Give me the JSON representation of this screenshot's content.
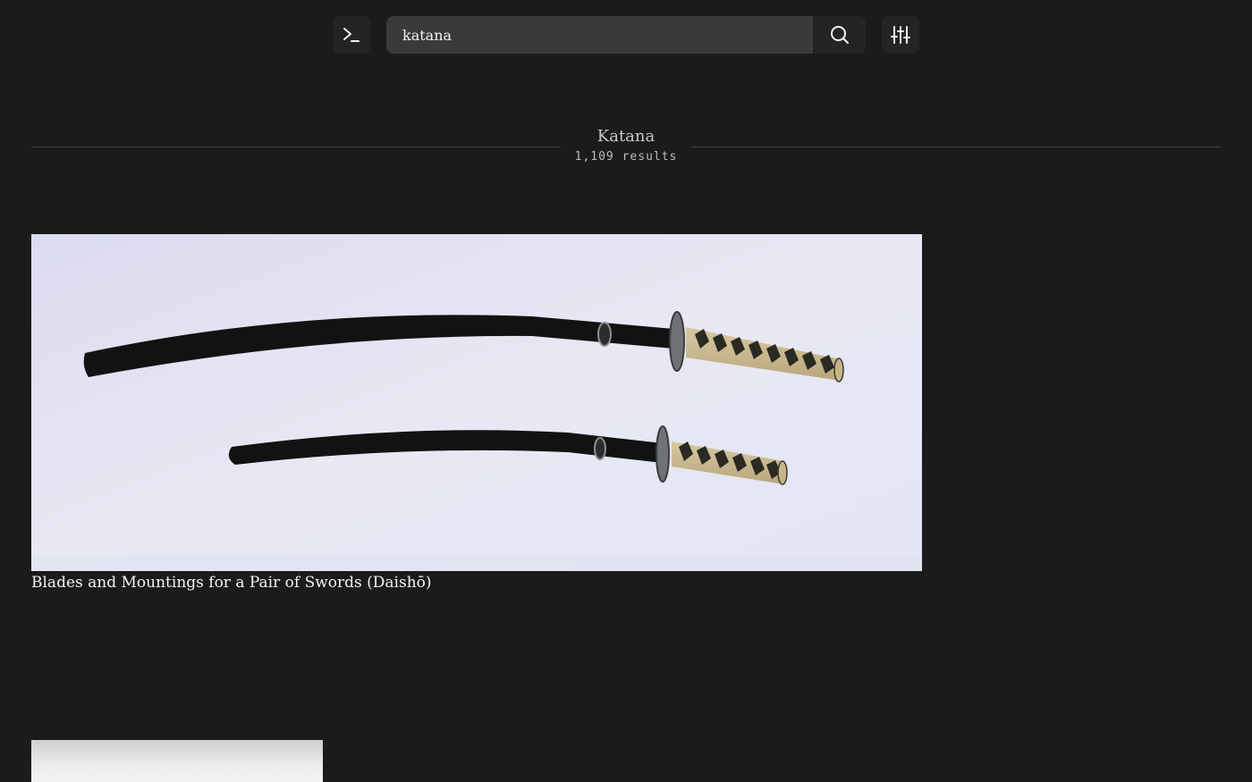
{
  "header": {
    "terminal_icon": "terminal-icon",
    "search_value": "katana",
    "search_icon": "search-icon",
    "filter_icon": "sliders-icon"
  },
  "results": {
    "title": "Katana",
    "count": "1,109 results",
    "items": [
      {
        "title": "Blades and Mountings for a Pair of Swords (Daishō)"
      },
      {
        "title": ""
      }
    ]
  },
  "colors": {
    "background": "#1b1b1b",
    "button_bg": "#242424",
    "input_bg": "#3a3a3a",
    "rule": "#444444"
  }
}
